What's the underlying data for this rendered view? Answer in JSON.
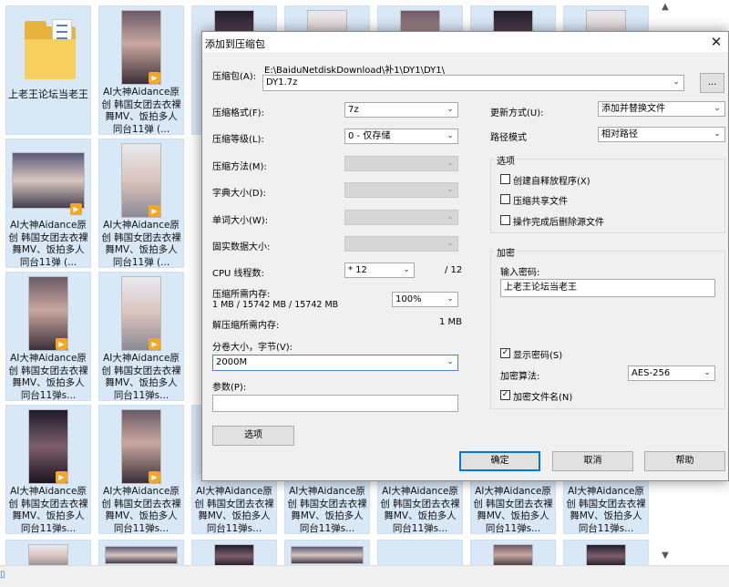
{
  "explorer": {
    "folder_name": "上老王论坛当老王",
    "video_caption_short": "AI大神Aidance原创 韩国女团去衣裸舞MV、饭拍多人同台11弹 (...",
    "video_caption_s": "AI大神Aidance原创 韩国女团去衣裸舞MV、饭拍多人同台11弹s...",
    "play_glyph": "▶",
    "scroll_up": "▲",
    "scroll_down": "▼",
    "status_glyph": "▯"
  },
  "dialog": {
    "title": "添加到压缩包",
    "close_glyph": "✕",
    "archive": {
      "label": "压缩包(A):",
      "path": "E:\\BaiduNetdiskDownload\\补1\\DY1\\DY1\\",
      "name": "DY1.7z",
      "browse_label": "..."
    },
    "format": {
      "label": "压缩格式(F):",
      "value": "7z"
    },
    "level": {
      "label": "压缩等级(L):",
      "value": "0 - 仅存储"
    },
    "method": {
      "label": "压缩方法(M):",
      "value": ""
    },
    "dict_size": {
      "label": "字典大小(D):",
      "value": ""
    },
    "word_size": {
      "label": "单词大小(W):",
      "value": ""
    },
    "solid_size": {
      "label": "固实数据大小:",
      "value": ""
    },
    "cpu_threads": {
      "label": "CPU 线程数:",
      "value": "* 12",
      "max": "/ 12"
    },
    "memory_compress": {
      "label": "压缩所需内存:",
      "detail": "1 MB / 15742 MB / 15742 MB",
      "percent": "100%"
    },
    "memory_decompress": {
      "label": "解压缩所需内存:",
      "value": "1 MB"
    },
    "volume": {
      "label": "分卷大小，字节(V):",
      "value": "2000M"
    },
    "params": {
      "label": "参数(P):",
      "value": ""
    },
    "options_button": "选项",
    "update_mode": {
      "label": "更新方式(U):",
      "value": "添加并替换文件"
    },
    "path_mode": {
      "label": "路径模式",
      "value": "相对路径"
    },
    "options_group": {
      "label": "选项",
      "sfx": {
        "label": "创建自释放程序(X)",
        "checked": false
      },
      "shared": {
        "label": "压缩共享文件",
        "checked": false
      },
      "delete_after": {
        "label": "操作完成后删除源文件",
        "checked": false
      }
    },
    "encryption": {
      "label": "加密",
      "password_label": "输入密码:",
      "password": "上老王论坛当老王",
      "show_password": {
        "label": "显示密码(S)",
        "checked": true
      },
      "method_label": "加密算法:",
      "method": "AES-256",
      "encrypt_names": {
        "label": "加密文件名(N)",
        "checked": true
      }
    },
    "ok": "确定",
    "cancel": "取消",
    "help": "帮助",
    "check_glyph": "✓",
    "arrow_glyph": "⌄"
  }
}
